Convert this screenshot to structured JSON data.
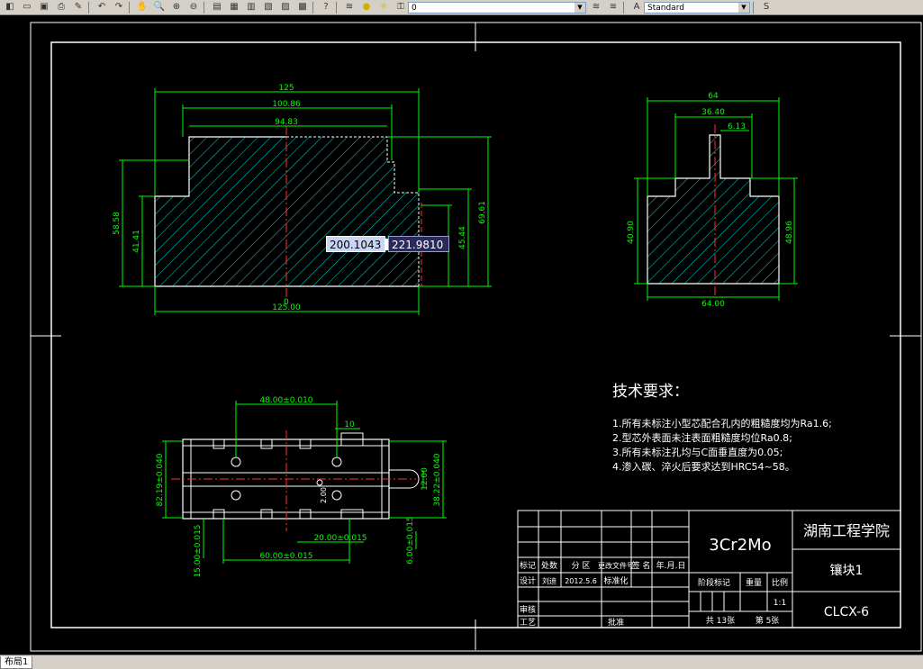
{
  "toolbar": {
    "layer_value": "0",
    "textstyle_value": "Standard",
    "right_partial": "S"
  },
  "layout_tab": "布局1",
  "dynamic_input": {
    "x": "200.1043",
    "y": "221.9810"
  },
  "drawing": {
    "front_view_dims": {
      "overall_width": "125",
      "upper_width": "100.86",
      "top_width": "94.83",
      "bottom_width": "125.00",
      "left_height_outer": "58.58",
      "left_height_inner": "41.41",
      "right_height_outer": "69.61",
      "right_height_inner": "45.44",
      "hole_mark": "0"
    },
    "side_view_dims": {
      "top_width": "64",
      "slot_width": "36.40",
      "slot_small": "6.13",
      "bottom_width": "64.00",
      "height_left": "40.90",
      "height_right": "48.96"
    },
    "top_view_dims": {
      "hole_span": "48.00±0.010",
      "slot_width": "10",
      "left_height": "82.19±0.040",
      "right_height": "38.22±0.040",
      "small_dim": "12.00",
      "bottom_center": "60.00±0.015",
      "bottom_right": "20.00±0.015",
      "left_vertical": "15.00±0.015",
      "right_vertical": "6.00±0.015",
      "center_mark": "2.00"
    },
    "tech_requirements": {
      "heading": "技术要求：",
      "items": [
        "1.所有未标注小型芯配合孔内的粗糙度均为Ra1.6;",
        "2.型芯外表面未注表面粗糙度均位Ra0.8;",
        "3.所有未标注孔均与C面垂直度为0.05;",
        "4.渗入碳、淬火后要求达到HRC54~58。"
      ]
    },
    "title_block": {
      "material": "3Cr2Mo",
      "school": "湖南工程学院",
      "part_name": "镶块1",
      "drawing_no": "CLCX-6",
      "header_labels": [
        "标记",
        "处数",
        "分 区",
        "更改文件号",
        "签 名",
        "年.月.日"
      ],
      "design_label": "设计",
      "designer": "刘迪",
      "date": "2012.5.6",
      "standardize_label": "标准化",
      "stage_label": "阶段标记",
      "weight_label": "重量",
      "scale_label": "比例",
      "scale_value": "1:1",
      "review_label": "审核",
      "process_label": "工艺",
      "approve_label": "批准",
      "sheets_total": "共 13张",
      "sheet_no": "第 5张"
    }
  }
}
